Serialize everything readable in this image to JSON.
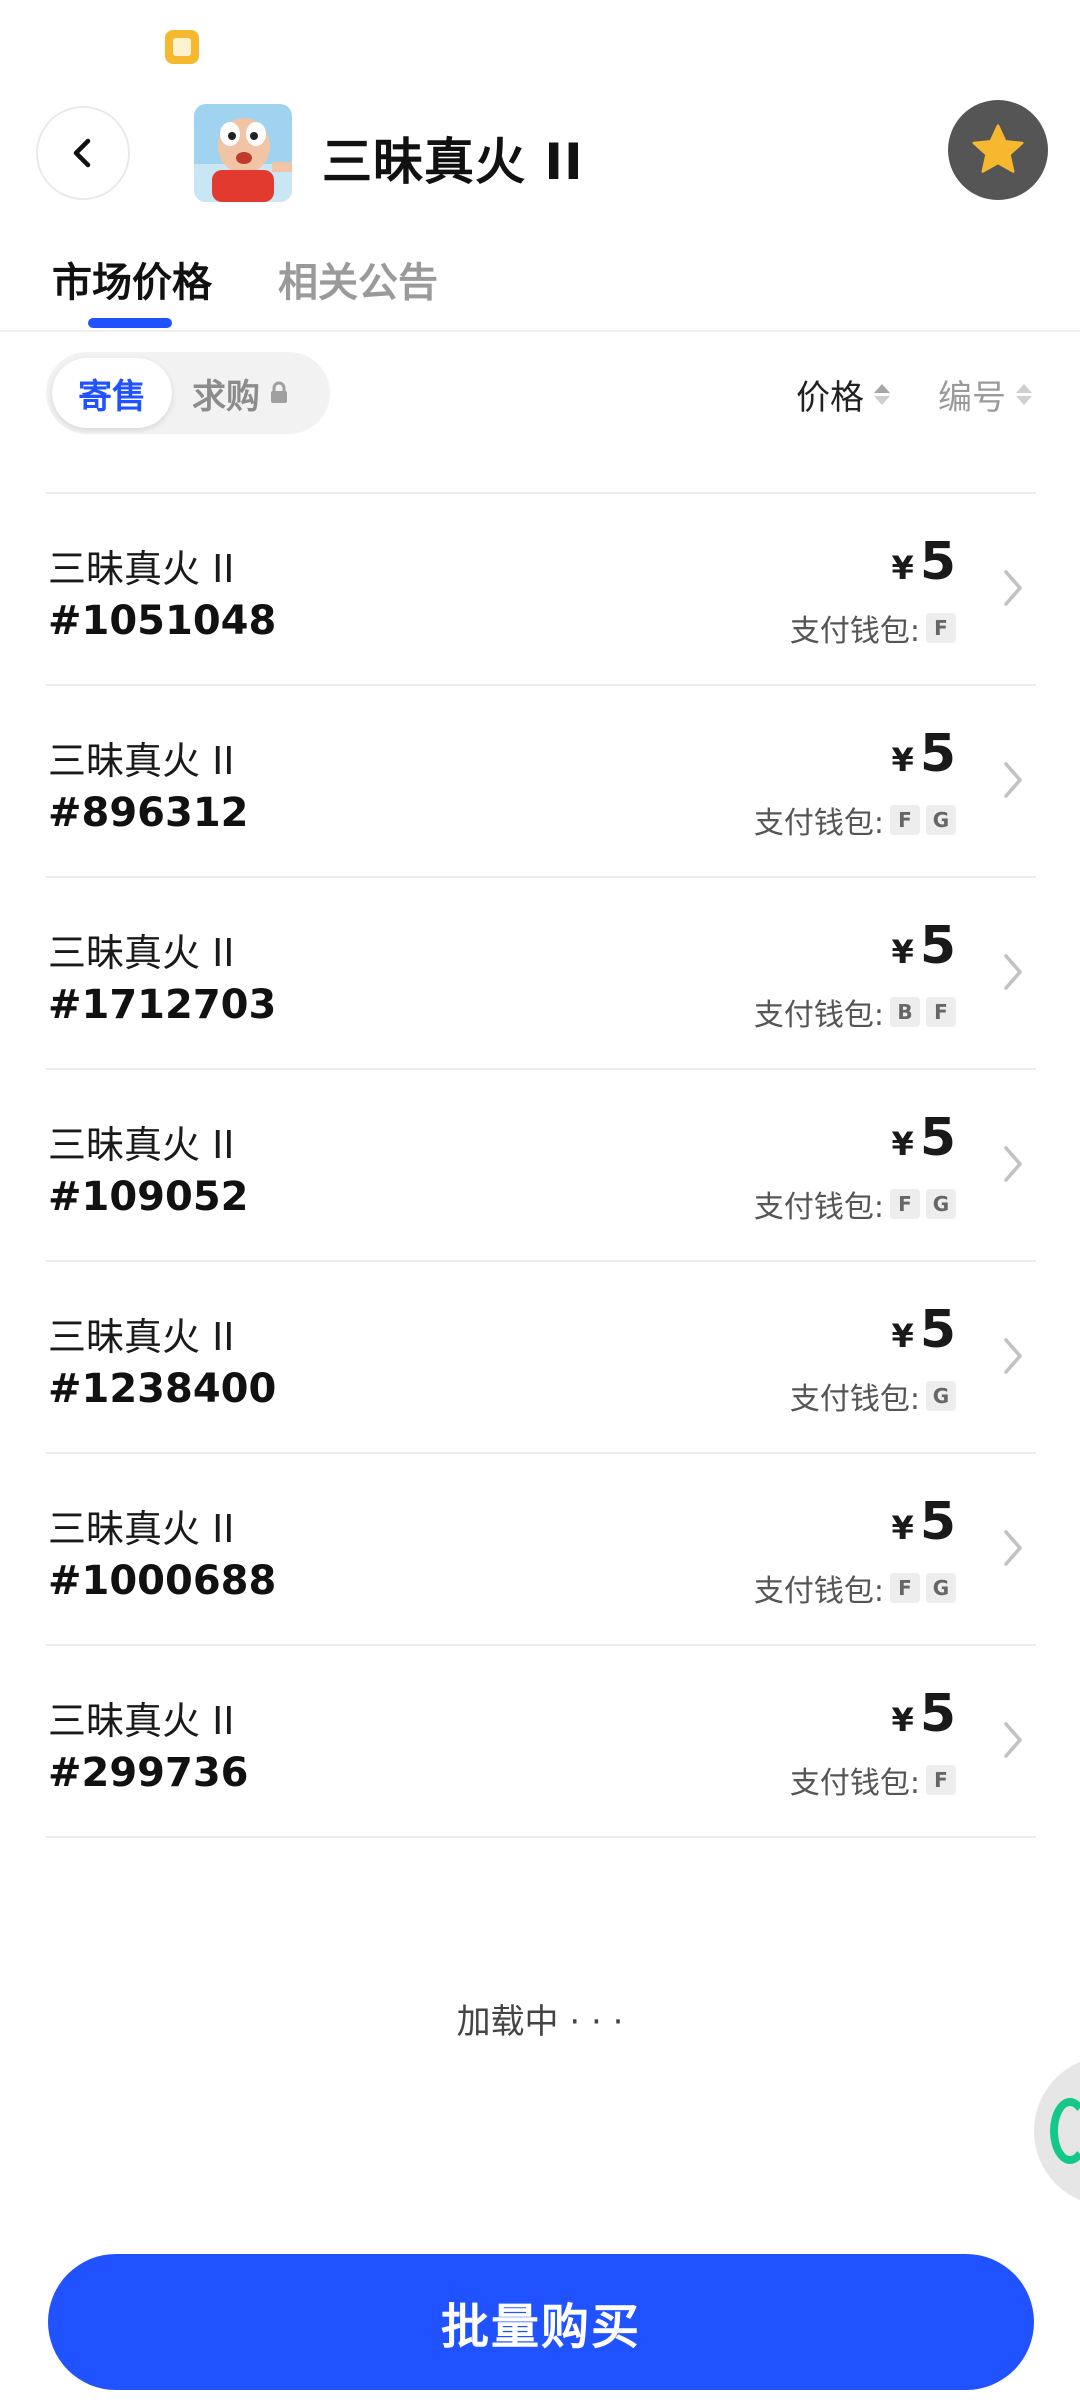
{
  "header": {
    "title": "三昧真火 II"
  },
  "tabs": [
    {
      "label": "市场价格",
      "active": true
    },
    {
      "label": "相关公告",
      "active": false
    }
  ],
  "filters": {
    "segment_sell": "寄售",
    "segment_buy": "求购",
    "sort_price": "价格",
    "sort_number": "编号"
  },
  "colors": {
    "accent": "#2152ff",
    "star": "#f5b82e"
  },
  "listings": [
    {
      "name": "三昧真火 II",
      "id": "#1051048",
      "currency": "¥",
      "price": "5",
      "wallet_label": "支付钱包:",
      "wallets": [
        "F"
      ]
    },
    {
      "name": "三昧真火 II",
      "id": "#896312",
      "currency": "¥",
      "price": "5",
      "wallet_label": "支付钱包:",
      "wallets": [
        "F",
        "G"
      ]
    },
    {
      "name": "三昧真火 II",
      "id": "#1712703",
      "currency": "¥",
      "price": "5",
      "wallet_label": "支付钱包:",
      "wallets": [
        "B",
        "F"
      ]
    },
    {
      "name": "三昧真火 II",
      "id": "#109052",
      "currency": "¥",
      "price": "5",
      "wallet_label": "支付钱包:",
      "wallets": [
        "F",
        "G"
      ]
    },
    {
      "name": "三昧真火 II",
      "id": "#1238400",
      "currency": "¥",
      "price": "5",
      "wallet_label": "支付钱包:",
      "wallets": [
        "G"
      ]
    },
    {
      "name": "三昧真火 II",
      "id": "#1000688",
      "currency": "¥",
      "price": "5",
      "wallet_label": "支付钱包:",
      "wallets": [
        "F",
        "G"
      ]
    },
    {
      "name": "三昧真火 II",
      "id": "#299736",
      "currency": "¥",
      "price": "5",
      "wallet_label": "支付钱包:",
      "wallets": [
        "F"
      ]
    }
  ],
  "loading": {
    "text": "加载中 · · ·"
  },
  "cta": {
    "label": "批量购买"
  }
}
